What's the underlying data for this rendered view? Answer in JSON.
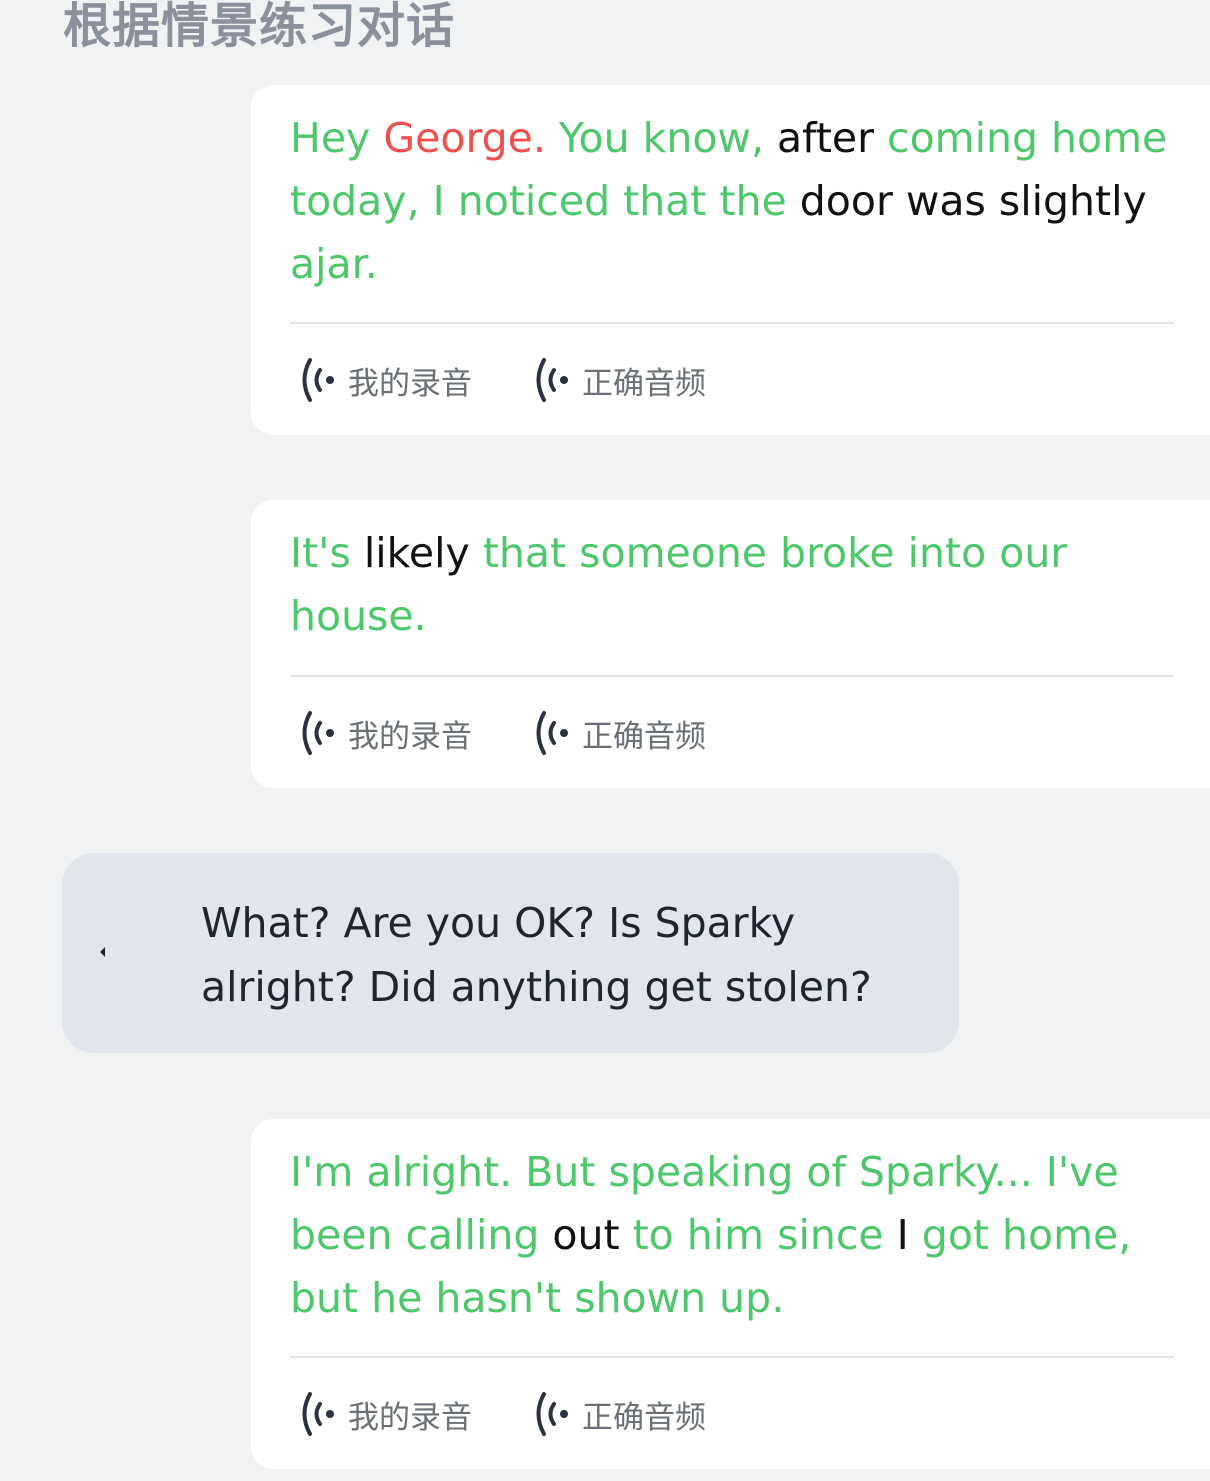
{
  "page": {
    "title": "根据情景练习对话"
  },
  "dialogue": [
    {
      "speaker": "user",
      "words": [
        {
          "t": "Hey ",
          "s": "good"
        },
        {
          "t": "George.",
          "s": "bad"
        },
        {
          "t": " You know, ",
          "s": "good"
        },
        {
          "t": "after",
          "s": "mid"
        },
        {
          "t": " coming home today, I noticed that the ",
          "s": "good"
        },
        {
          "t": "door was slightly",
          "s": "mid"
        },
        {
          "t": " ajar.",
          "s": "good"
        }
      ],
      "my_recording_label": "我的录音",
      "correct_audio_label": "正确音频"
    },
    {
      "speaker": "user",
      "words": [
        {
          "t": "It's ",
          "s": "good"
        },
        {
          "t": "likely",
          "s": "mid"
        },
        {
          "t": " that someone broke into our house.",
          "s": "good"
        }
      ],
      "my_recording_label": "我的录音",
      "correct_audio_label": "正确音频"
    },
    {
      "speaker": "partner",
      "text": "What? Are you OK? Is Sparky alright? Did anything get stolen?"
    },
    {
      "speaker": "user",
      "words": [
        {
          "t": "I'm alright. But speaking of Sparky... I've been calling ",
          "s": "good"
        },
        {
          "t": "out",
          "s": "mid"
        },
        {
          "t": " to him since ",
          "s": "good"
        },
        {
          "t": "I",
          "s": "mid"
        },
        {
          "t": " got home, but he hasn't shown up.",
          "s": "good"
        }
      ],
      "my_recording_label": "我的录音",
      "correct_audio_label": "正确音频"
    }
  ],
  "colors": {
    "correct_word": "#4ec66b",
    "wrong_word": "#ee5050",
    "neutral_word": "#111111",
    "partner_bubble": "#e1e5ec",
    "background": "#f1f2f4"
  },
  "icons": {
    "audio": "sound-wave-icon",
    "partner_play": "play-indicator-icon"
  }
}
